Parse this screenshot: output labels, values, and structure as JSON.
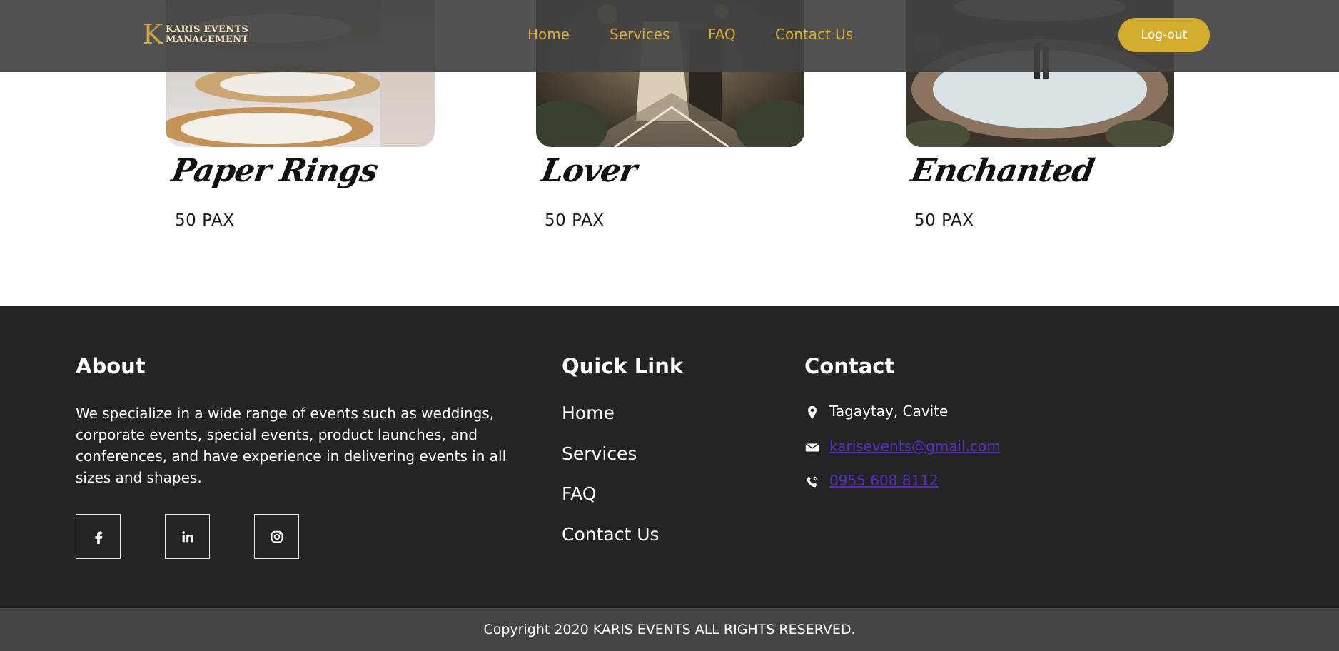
{
  "header": {
    "logo_line1": "KARIS EVENTS",
    "logo_line2": "MANAGEMENT",
    "nav": [
      "Home",
      "Services",
      "FAQ",
      "Contact Us"
    ],
    "logout_label": "Log-out"
  },
  "packages": [
    {
      "name": "Paper Rings",
      "pax": "50 PAX"
    },
    {
      "name": "Lover",
      "pax": "50 PAX"
    },
    {
      "name": "Enchanted",
      "pax": "50 PAX"
    }
  ],
  "footer": {
    "about_title": "About",
    "about_text": "We specialize in a wide range of events such as weddings, corporate events, special events, product launches, and conferences, and have experience in delivering events in all sizes and shapes.",
    "social_icons": [
      "facebook-icon",
      "linkedin-icon",
      "instagram-icon"
    ],
    "quick_link_title": "Quick Link",
    "quick_links": [
      "Home",
      "Services",
      "FAQ",
      "Contact Us"
    ],
    "contact_title": "Contact",
    "contact": {
      "address": "Tagaytay, Cavite",
      "email": "karisevents@gmail.com",
      "phone": "0955 608 8112"
    }
  },
  "copyright": "Copyright 2020 KARIS EVENTS ALL RIGHTS RESERVED.",
  "colors": {
    "accent_gold": "#d4ac2f",
    "nav_text": "#d6ad38",
    "header_bg": "#424242",
    "footer_bg": "#242424",
    "copyright_bg": "#444444",
    "link_purple": "#5a2bc4"
  }
}
